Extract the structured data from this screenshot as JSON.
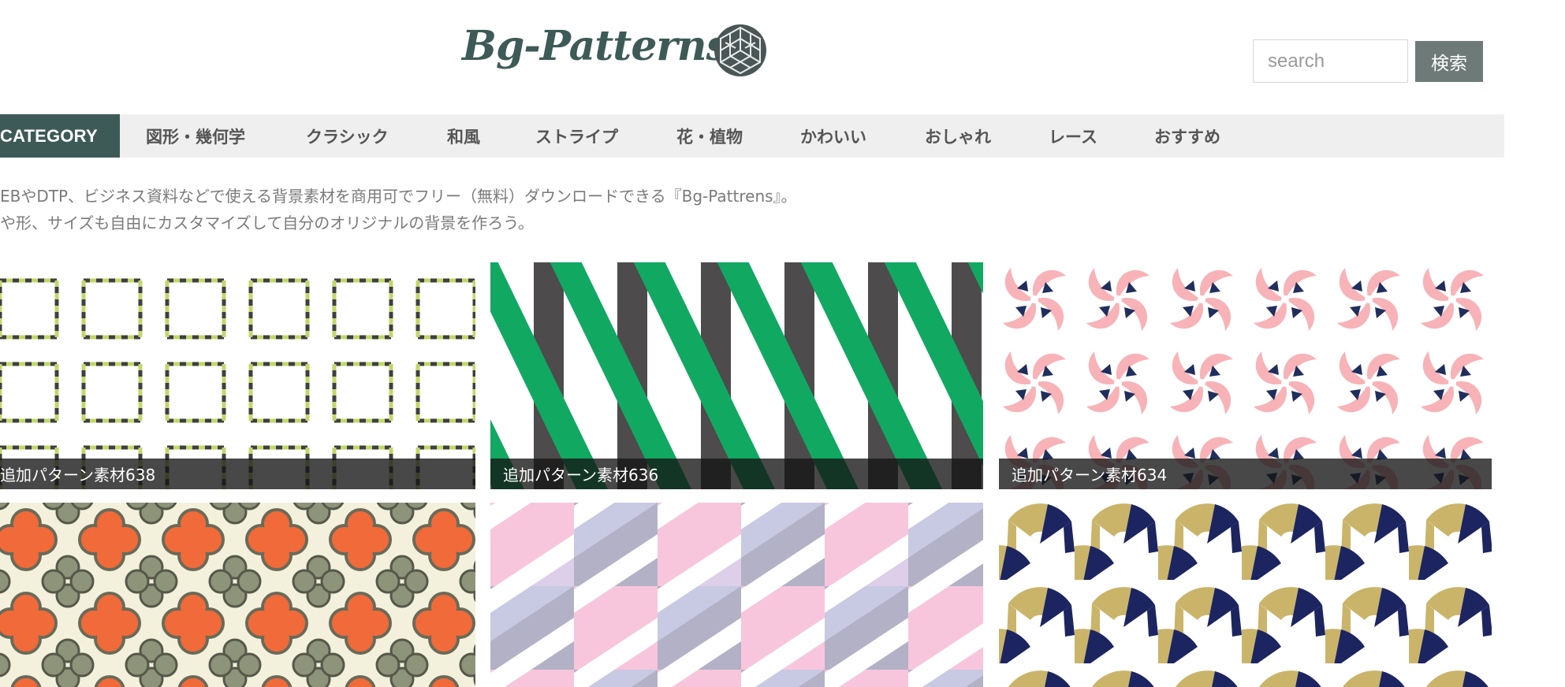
{
  "header": {
    "logo_text": "Bg-Patterns",
    "logo_icon": "geometric-cube-icon",
    "search_placeholder": "search",
    "search_value": "",
    "search_button_label": "検索"
  },
  "nav": {
    "category_label": "CATEGORY",
    "items": [
      "図形・幾何学",
      "クラシック",
      "和風",
      "ストライプ",
      "花・植物",
      "かわいい",
      "おしゃれ",
      "レース",
      "おすすめ"
    ]
  },
  "description": {
    "line1": "EBやDTP、ビジネス資料などで使える背景素材を商用可でフリー（無料）ダウンロードできる『Bg-Pattrens』。",
    "line2": "や形、サイズも自由にカスタマイズして自分のオリジナルの背景を作ろう。"
  },
  "cards": [
    {
      "title": "追加パターン素材638"
    },
    {
      "title": "追加パターン素材636"
    },
    {
      "title": "追加パターン素材634"
    },
    {
      "title": ""
    },
    {
      "title": ""
    },
    {
      "title": ""
    }
  ],
  "colors": {
    "brand": "#3d5a57",
    "nav_bg": "#efefef",
    "search_button": "#6e7a78",
    "caption_bg": "#141414"
  }
}
